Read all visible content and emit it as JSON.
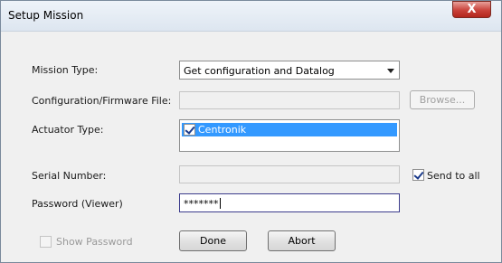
{
  "window": {
    "title": "Setup Mission",
    "close_glyph": "X"
  },
  "mission_type": {
    "label": "Mission Type:",
    "value": "Get configuration and Datalog"
  },
  "config_file": {
    "label": "Configuration/Firmware File:",
    "value": "",
    "browse_label": "Browse..."
  },
  "actuator_type": {
    "label": "Actuator Type:",
    "items": [
      {
        "label": "Centronik",
        "checked": true,
        "selected": true
      }
    ]
  },
  "serial_number": {
    "label": "Serial Number:",
    "value": "",
    "send_to_all_label": "Send to all",
    "send_to_all_checked": true
  },
  "password": {
    "label": "Password (Viewer)",
    "value": "*******"
  },
  "show_password": {
    "label": "Show Password",
    "checked": false,
    "enabled": false
  },
  "buttons": {
    "done": "Done",
    "abort": "Abort"
  },
  "colors": {
    "selection": "#3399ff",
    "close_button": "#c9423a",
    "focus_border": "#3c3c8c"
  }
}
